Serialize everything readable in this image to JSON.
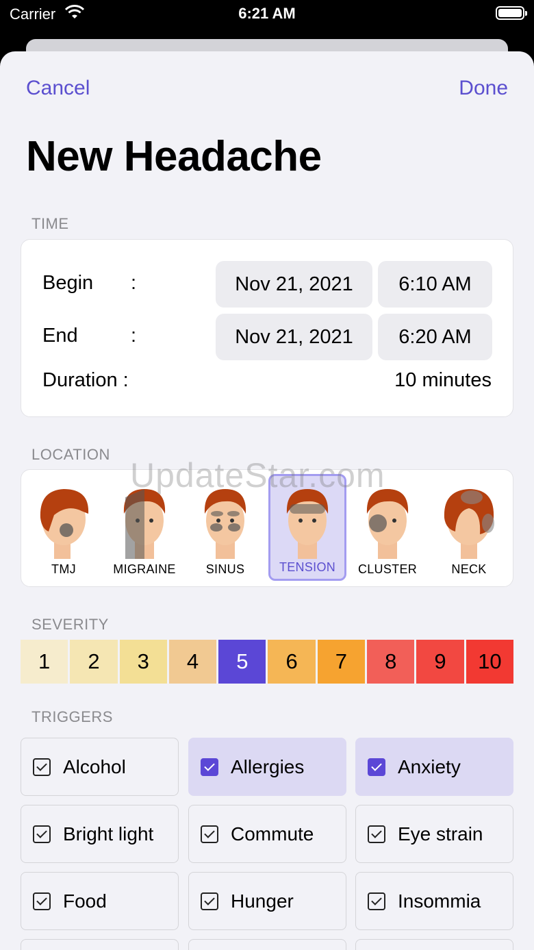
{
  "status_bar": {
    "carrier": "Carrier",
    "time": "6:21 AM"
  },
  "nav": {
    "cancel": "Cancel",
    "done": "Done"
  },
  "title": "New Headache",
  "time_section": {
    "label": "TIME",
    "begin": {
      "label": "Begin",
      "date": "Nov 21, 2021",
      "time": "6:10 AM"
    },
    "end": {
      "label": "End",
      "date": "Nov 21, 2021",
      "time": "6:20 AM"
    },
    "duration": {
      "label": "Duration :",
      "value": "10 minutes"
    },
    "colon": ":"
  },
  "location_section": {
    "label": "LOCATION",
    "items": [
      {
        "label": "TMJ",
        "selected": false
      },
      {
        "label": "MIGRAINE",
        "selected": false
      },
      {
        "label": "SINUS",
        "selected": false
      },
      {
        "label": "TENSION",
        "selected": true
      },
      {
        "label": "CLUSTER",
        "selected": false
      },
      {
        "label": "NECK",
        "selected": false
      }
    ]
  },
  "watermark": "UpdateStar.com",
  "severity_section": {
    "label": "SEVERITY",
    "levels": [
      "1",
      "2",
      "3",
      "4",
      "5",
      "6",
      "7",
      "8",
      "9",
      "10"
    ],
    "colors": [
      "#f6eccd",
      "#f5e6b3",
      "#f3df95",
      "#f1c992",
      "#5b47d6",
      "#f5b655",
      "#f6a330",
      "#f25f58",
      "#f24841",
      "#f23932"
    ],
    "selected": "5"
  },
  "triggers_section": {
    "label": "TRIGGERS",
    "items": [
      {
        "label": "Alcohol",
        "checked": false
      },
      {
        "label": "Allergies",
        "checked": true
      },
      {
        "label": "Anxiety",
        "checked": true
      },
      {
        "label": "Bright light",
        "checked": false
      },
      {
        "label": "Commute",
        "checked": false
      },
      {
        "label": "Eye strain",
        "checked": false
      },
      {
        "label": "Food",
        "checked": false
      },
      {
        "label": "Hunger",
        "checked": false
      },
      {
        "label": "Insommia",
        "checked": false
      }
    ]
  },
  "colors": {
    "accent": "#5b4fcf",
    "sheet_bg": "#f2f2f7",
    "selected_bg": "#dcd9f3"
  }
}
